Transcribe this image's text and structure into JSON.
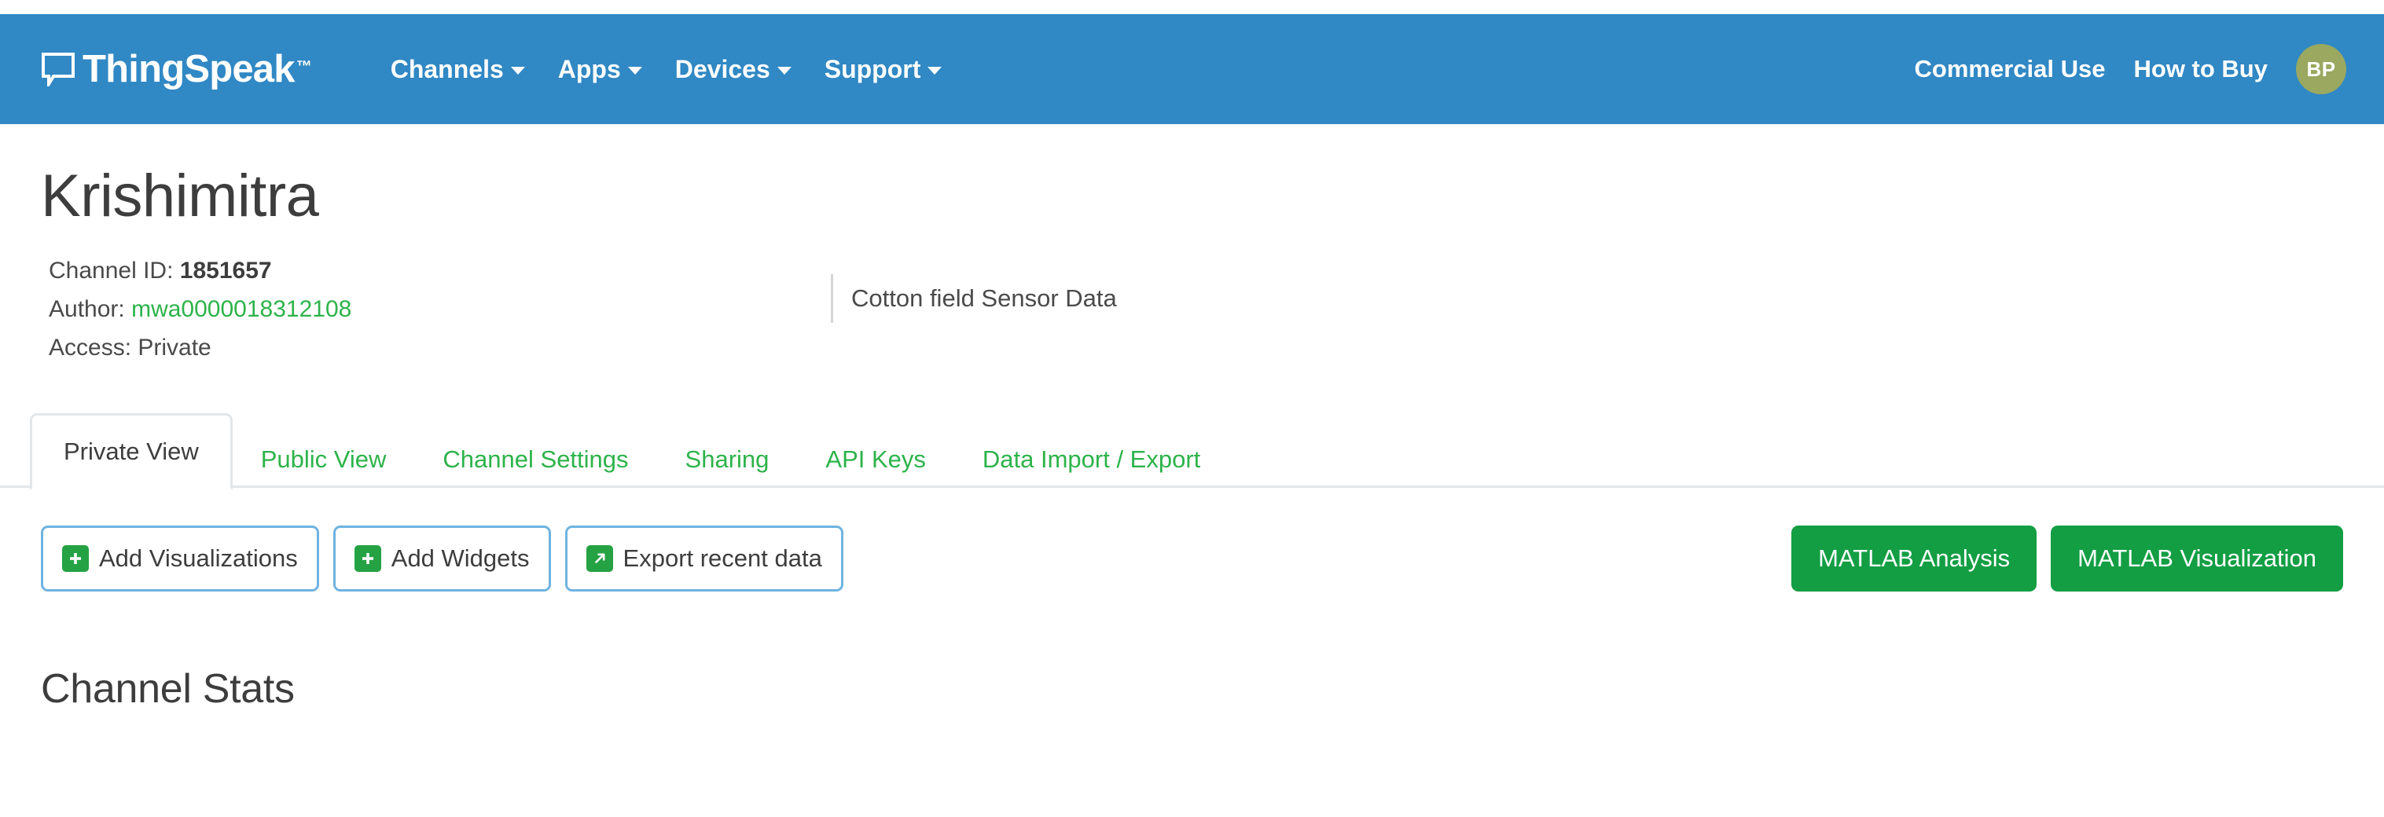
{
  "navbar": {
    "brand": "ThingSpeak",
    "brand_tm": "™",
    "brand_icon": "speech-bubble-icon",
    "items": [
      {
        "label": "Channels",
        "has_caret": true
      },
      {
        "label": "Apps",
        "has_caret": true
      },
      {
        "label": "Devices",
        "has_caret": true
      },
      {
        "label": "Support",
        "has_caret": true
      }
    ],
    "right_links": [
      {
        "label": "Commercial Use"
      },
      {
        "label": "How to Buy"
      }
    ],
    "avatar_initials": "BP",
    "background_color": "#3088c4",
    "avatar_color": "#9aa860"
  },
  "channel": {
    "title": "Krishimitra",
    "channel_id_label": "Channel ID:",
    "channel_id_value": "1851657",
    "author_label": "Author:",
    "author_value": "mwa0000018312108",
    "access_label": "Access:",
    "access_value": "Private",
    "description": "Cotton field Sensor Data",
    "link_color": "#2db34a"
  },
  "tabs": [
    {
      "label": "Private View",
      "active": true
    },
    {
      "label": "Public View",
      "active": false
    },
    {
      "label": "Channel Settings",
      "active": false
    },
    {
      "label": "Sharing",
      "active": false
    },
    {
      "label": "API Keys",
      "active": false
    },
    {
      "label": "Data Import / Export",
      "active": false
    }
  ],
  "toolbar": {
    "add_visualizations_label": "Add Visualizations",
    "add_widgets_label": "Add Widgets",
    "export_recent_data_label": "Export recent data",
    "matlab_analysis_label": "MATLAB Analysis",
    "matlab_visualization_label": "MATLAB Visualization",
    "icons": {
      "add_visualizations": "plus-icon",
      "add_widgets": "plus-icon",
      "export_recent_data": "external-link-arrow-icon"
    },
    "button_border_color": "#6fb3e0",
    "green_button_color": "#139e43"
  },
  "main": {
    "section_heading": "Channel Stats"
  }
}
